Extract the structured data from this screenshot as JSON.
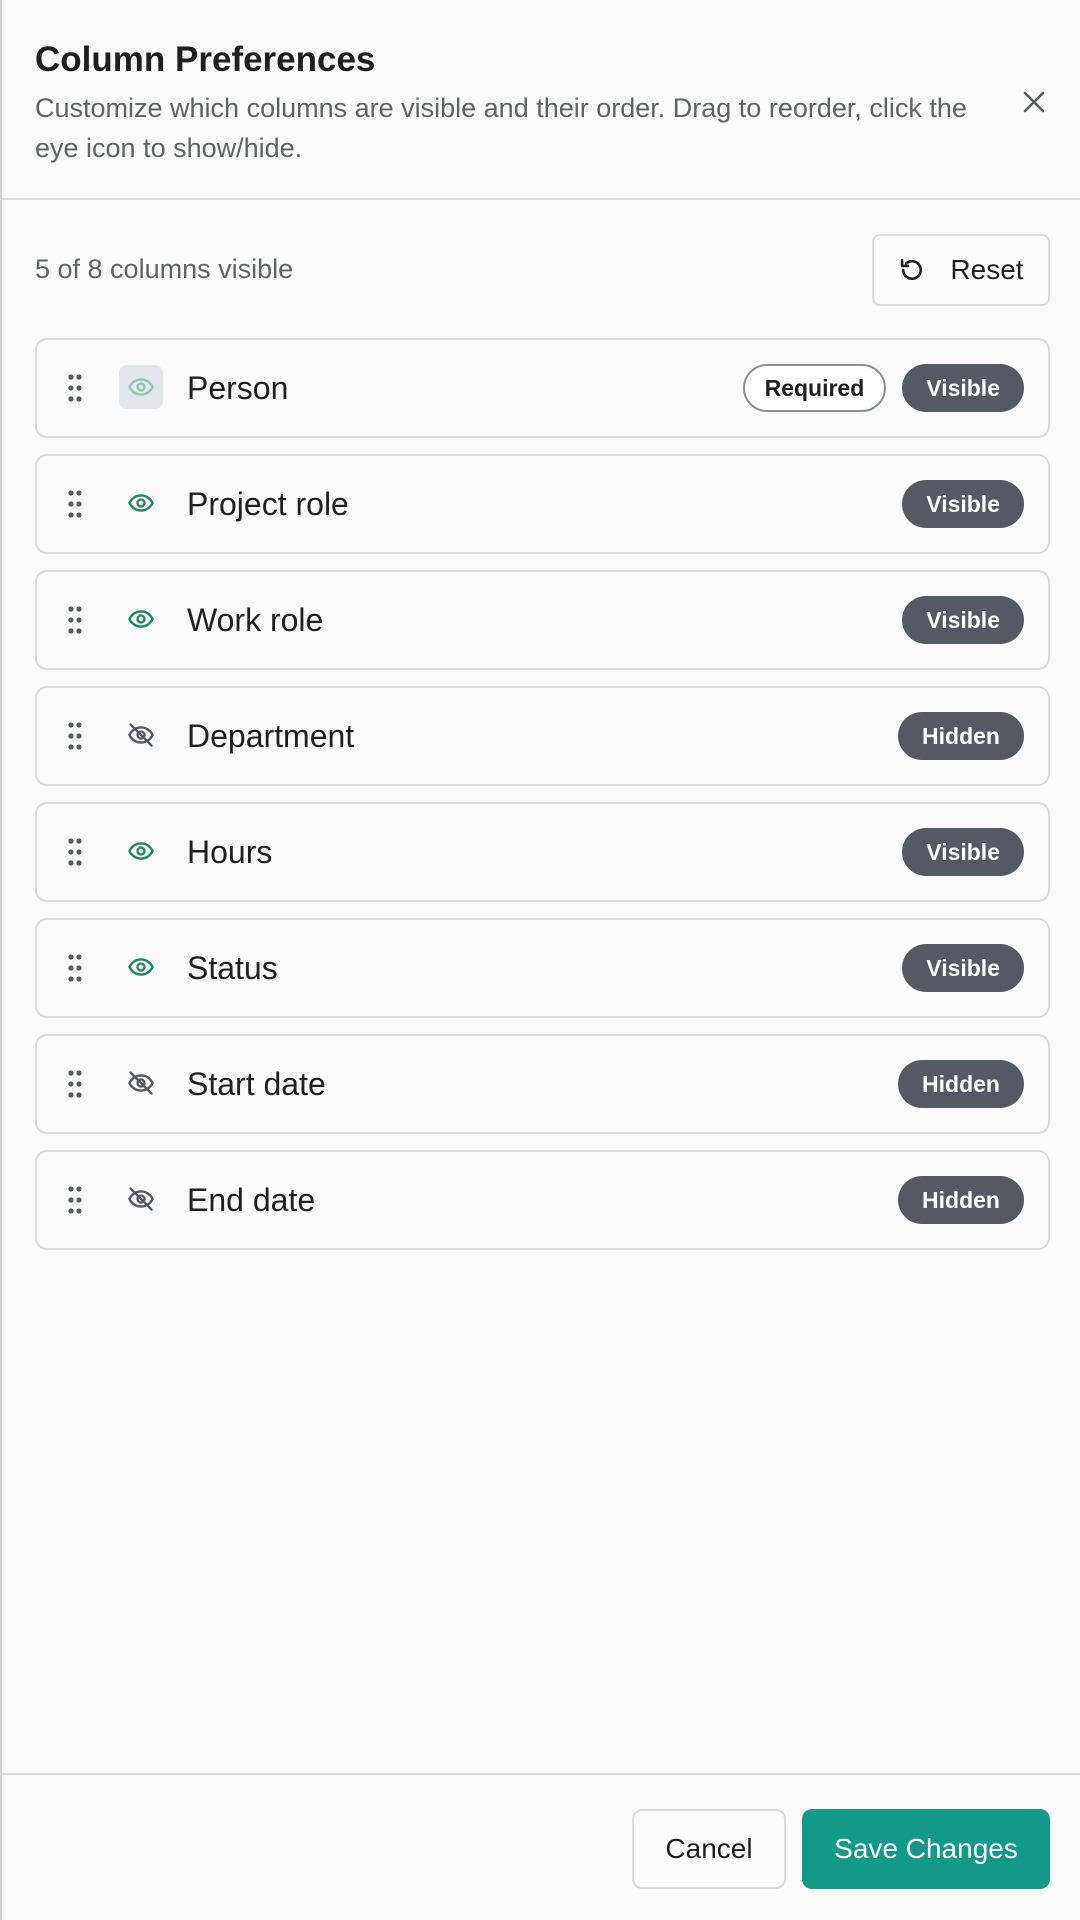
{
  "header": {
    "title": "Column Preferences",
    "subtitle": "Customize which columns are visible and their order. Drag to reorder, click the eye icon to show/hide."
  },
  "toolbar": {
    "count_text": "5 of 8 columns visible",
    "reset_label": "Reset"
  },
  "columns": [
    {
      "label": "Person",
      "required": true,
      "required_label": "Required",
      "visible": true,
      "status": "Visible"
    },
    {
      "label": "Project role",
      "required": false,
      "visible": true,
      "status": "Visible"
    },
    {
      "label": "Work role",
      "required": false,
      "visible": true,
      "status": "Visible"
    },
    {
      "label": "Department",
      "required": false,
      "visible": false,
      "status": "Hidden"
    },
    {
      "label": "Hours",
      "required": false,
      "visible": true,
      "status": "Visible"
    },
    {
      "label": "Status",
      "required": false,
      "visible": true,
      "status": "Visible"
    },
    {
      "label": "Start date",
      "required": false,
      "visible": false,
      "status": "Hidden"
    },
    {
      "label": "End date",
      "required": false,
      "visible": false,
      "status": "Hidden"
    }
  ],
  "footer": {
    "cancel_label": "Cancel",
    "save_label": "Save Changes"
  },
  "colors": {
    "eye_visible": "#1a8a5c",
    "eye_disabled": "#8fc9ad",
    "eye_hidden": "#555963",
    "primary": "#12998a",
    "badge_dark": "#555963"
  },
  "icons": {
    "close": "close-icon",
    "reset": "reset-icon",
    "drag": "drag-handle-icon",
    "visible": "eye-icon",
    "hidden": "eye-off-icon"
  }
}
